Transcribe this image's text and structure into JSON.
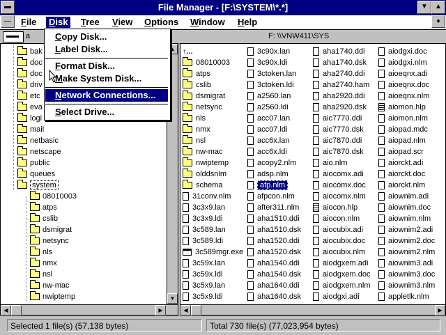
{
  "window": {
    "title": "File Manager - [F:\\SYSTEM\\*.*]"
  },
  "menubar": [
    "File",
    "Disk",
    "Tree",
    "View",
    "Options",
    "Window",
    "Help"
  ],
  "menubar_active": "Disk",
  "disk_menu": {
    "items": [
      "Copy Disk...",
      "Label Disk...",
      "Format Disk...",
      "Make System Disk...",
      "Network Connections...",
      "Select Drive..."
    ],
    "highlighted": "Network Connections..."
  },
  "drivebar": {
    "drive_letter": "a",
    "path_label": "F: \\\\VNW411\\SYS"
  },
  "tree": {
    "items": [
      {
        "label": "bak",
        "level": 1
      },
      {
        "label": "doc",
        "level": 1
      },
      {
        "label": "doc",
        "level": 1
      },
      {
        "label": "driv",
        "level": 1
      },
      {
        "label": "etc",
        "level": 1
      },
      {
        "label": "eva",
        "level": 1
      },
      {
        "label": "logi",
        "level": 1
      },
      {
        "label": "mail",
        "level": 1
      },
      {
        "label": "netbasic",
        "level": 1
      },
      {
        "label": "netscape",
        "level": 1
      },
      {
        "label": "public",
        "level": 1
      },
      {
        "label": "queues",
        "level": 1
      },
      {
        "label": "system",
        "level": 1,
        "open": true,
        "selected": true
      },
      {
        "label": "08010003",
        "level": 2
      },
      {
        "label": "atps",
        "level": 2
      },
      {
        "label": "cslib",
        "level": 2
      },
      {
        "label": "dsmigrat",
        "level": 2
      },
      {
        "label": "netsync",
        "level": 2
      },
      {
        "label": "nls",
        "level": 2
      },
      {
        "label": "nmx",
        "level": 2
      },
      {
        "label": "nsl",
        "level": 2
      },
      {
        "label": "nw-mac",
        "level": 2
      },
      {
        "label": "nwiptemp",
        "level": 2
      }
    ]
  },
  "files": {
    "columns": [
      [
        {
          "n": "..",
          "t": "up"
        },
        {
          "n": "08010003",
          "t": "dir"
        },
        {
          "n": "atps",
          "t": "dir"
        },
        {
          "n": "cslib",
          "t": "dir"
        },
        {
          "n": "dsmigrat",
          "t": "dir"
        },
        {
          "n": "netsync",
          "t": "dir"
        },
        {
          "n": "nls",
          "t": "dir"
        },
        {
          "n": "nmx",
          "t": "dir"
        },
        {
          "n": "nsl",
          "t": "dir"
        },
        {
          "n": "nw-mac",
          "t": "dir"
        },
        {
          "n": "nwiptemp",
          "t": "dir"
        },
        {
          "n": "olddsnlm",
          "t": "dir"
        },
        {
          "n": "schema",
          "t": "dir"
        },
        {
          "n": "31conv.nlm",
          "t": "f"
        },
        {
          "n": "3c3x9.lan",
          "t": "f"
        },
        {
          "n": "3c3x9.ldi",
          "t": "f"
        },
        {
          "n": "3c589.lan",
          "t": "f"
        },
        {
          "n": "3c589.ldi",
          "t": "f"
        },
        {
          "n": "3c589mgr.exe",
          "t": "exe"
        },
        {
          "n": "3c59x.lan",
          "t": "f"
        },
        {
          "n": "3c59x.ldi",
          "t": "f"
        },
        {
          "n": "3c5x9.lan",
          "t": "f"
        },
        {
          "n": "3c5x9.ldi",
          "t": "f"
        }
      ],
      [
        {
          "n": "3c90x.lan",
          "t": "f"
        },
        {
          "n": "3c90x.ldi",
          "t": "f"
        },
        {
          "n": "3ctoken.lan",
          "t": "f"
        },
        {
          "n": "3ctoken.ldi",
          "t": "f"
        },
        {
          "n": "a2560.lan",
          "t": "f"
        },
        {
          "n": "a2560.ldi",
          "t": "f"
        },
        {
          "n": "acc07.lan",
          "t": "f"
        },
        {
          "n": "acc07.ldi",
          "t": "f"
        },
        {
          "n": "acc6x.lan",
          "t": "f"
        },
        {
          "n": "acc6x.ldi",
          "t": "f"
        },
        {
          "n": "acopy2.nlm",
          "t": "f"
        },
        {
          "n": "adsp.nlm",
          "t": "f"
        },
        {
          "n": "afp.nlm",
          "t": "f",
          "sel": true
        },
        {
          "n": "afpcon.nlm",
          "t": "f"
        },
        {
          "n": "after311.nlm",
          "t": "f"
        },
        {
          "n": "aha1510.ddi",
          "t": "f"
        },
        {
          "n": "aha1510.dsk",
          "t": "f"
        },
        {
          "n": "aha1520.ddi",
          "t": "f"
        },
        {
          "n": "aha1520.dsk",
          "t": "f"
        },
        {
          "n": "aha1540.ddi",
          "t": "f"
        },
        {
          "n": "aha1540.dsk",
          "t": "f"
        },
        {
          "n": "aha1640.ddi",
          "t": "f"
        },
        {
          "n": "aha1640.dsk",
          "t": "f"
        }
      ],
      [
        {
          "n": "aha1740.ddi",
          "t": "f"
        },
        {
          "n": "aha1740.dsk",
          "t": "f"
        },
        {
          "n": "aha2740.ddi",
          "t": "f"
        },
        {
          "n": "aha2740.ham",
          "t": "f"
        },
        {
          "n": "aha2920.ddi",
          "t": "f"
        },
        {
          "n": "aha2920.dsk",
          "t": "f"
        },
        {
          "n": "aic7770.ddi",
          "t": "f"
        },
        {
          "n": "aic7770.dsk",
          "t": "f"
        },
        {
          "n": "aic7870.ddi",
          "t": "f"
        },
        {
          "n": "aic7870.dsk",
          "t": "f"
        },
        {
          "n": "aio.nlm",
          "t": "f"
        },
        {
          "n": "aiocomx.adi",
          "t": "f"
        },
        {
          "n": "aiocomx.doc",
          "t": "f"
        },
        {
          "n": "aiocomx.nlm",
          "t": "f"
        },
        {
          "n": "aiocon.hlp",
          "t": "hlp"
        },
        {
          "n": "aiocon.nlm",
          "t": "f"
        },
        {
          "n": "aiocubix.adi",
          "t": "f"
        },
        {
          "n": "aiocubix.doc",
          "t": "f"
        },
        {
          "n": "aiocubix.nlm",
          "t": "f"
        },
        {
          "n": "aiodgxem.adi",
          "t": "f"
        },
        {
          "n": "aiodgxem.doc",
          "t": "f"
        },
        {
          "n": "aiodgxem.nlm",
          "t": "f"
        },
        {
          "n": "aiodgxi.adi",
          "t": "f"
        }
      ],
      [
        {
          "n": "aiodgxi.doc",
          "t": "f"
        },
        {
          "n": "aiodgxi.nlm",
          "t": "f"
        },
        {
          "n": "aioeqnx.adi",
          "t": "f"
        },
        {
          "n": "aioeqnx.doc",
          "t": "f"
        },
        {
          "n": "aioeqnx.nlm",
          "t": "f"
        },
        {
          "n": "aiomon.hlp",
          "t": "hlp"
        },
        {
          "n": "aiomon.nlm",
          "t": "f"
        },
        {
          "n": "aiopad.mdc",
          "t": "f"
        },
        {
          "n": "aiopad.nlm",
          "t": "f"
        },
        {
          "n": "aiopad.scr",
          "t": "f"
        },
        {
          "n": "aiorckt.adi",
          "t": "f"
        },
        {
          "n": "aiorckt.doc",
          "t": "f"
        },
        {
          "n": "aiorckt.nlm",
          "t": "f"
        },
        {
          "n": "aiownim.adi",
          "t": "f"
        },
        {
          "n": "aiownim.doc",
          "t": "f"
        },
        {
          "n": "aiownim.nlm",
          "t": "f"
        },
        {
          "n": "aiownim2.adi",
          "t": "f"
        },
        {
          "n": "aiownim2.doc",
          "t": "f"
        },
        {
          "n": "aiownim2.nlm",
          "t": "f"
        },
        {
          "n": "aiownim3.adi",
          "t": "f"
        },
        {
          "n": "aiownim3.doc",
          "t": "f"
        },
        {
          "n": "aiownim3.nlm",
          "t": "f"
        },
        {
          "n": "appletlk.nlm",
          "t": "f"
        }
      ]
    ]
  },
  "status": {
    "selected": "Selected 1 file(s) (57,138 bytes)",
    "total": "Total 730 file(s) (77,023,954 bytes)"
  }
}
